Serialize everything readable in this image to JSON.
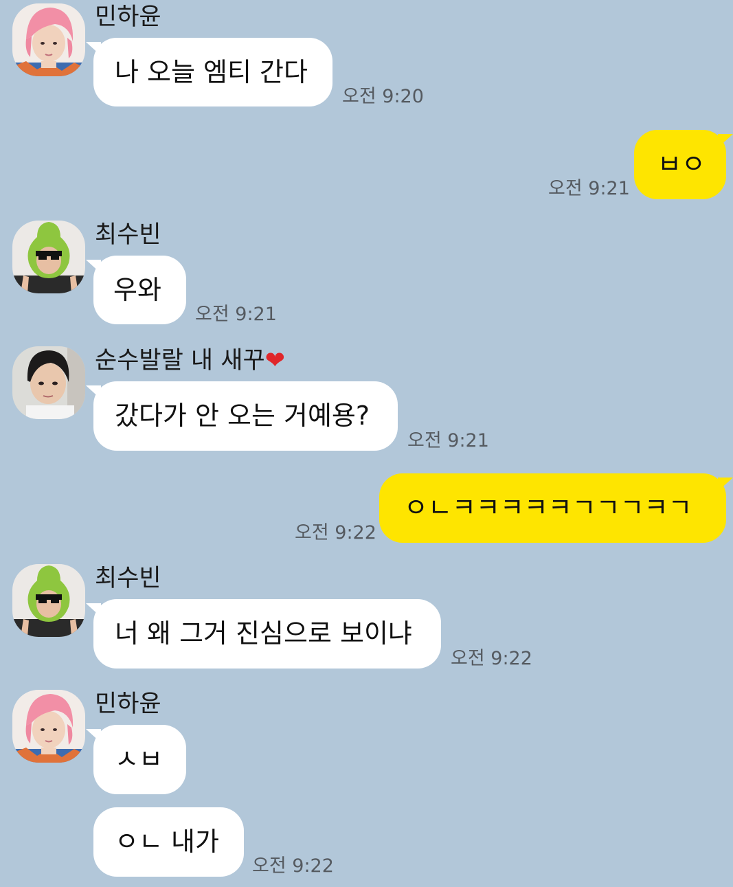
{
  "messages": [
    {
      "sender": "민하윤",
      "text": "나 오늘 엠티 간다",
      "time": "오전 9:20"
    },
    {
      "sender": "me",
      "text": "ㅂㅇ",
      "time": "오전 9:21"
    },
    {
      "sender": "최수빈",
      "text": "우와",
      "time": "오전 9:21"
    },
    {
      "sender": "순수발랄 내 새꾸",
      "sender_emoji": "❤️",
      "text": "갔다가 안 오는 거예용?",
      "time": "오전 9:21"
    },
    {
      "sender": "me",
      "text": "ㅇㄴㅋㅋㅋㅋㅋㄱㄱㄱㅋㄱ",
      "time": "오전 9:22"
    },
    {
      "sender": "최수빈",
      "text": "너 왜 그거 진심으로 보이냐",
      "time": "오전 9:22"
    },
    {
      "sender": "민하윤",
      "texts": [
        "ㅅㅂ",
        "ㅇㄴ 내가"
      ],
      "time": "오전 9:22"
    }
  ],
  "colors": {
    "background": "#b2c7d9",
    "incoming_bubble": "#ffffff",
    "outgoing_bubble": "#fee500",
    "time_text": "#555a60",
    "heart": "#e0262a"
  },
  "avatars": {
    "minhayun": "pink-hair-avatar",
    "choisubin": "avocado-costume-avatar",
    "sunsu": "dark-hair-avatar"
  }
}
